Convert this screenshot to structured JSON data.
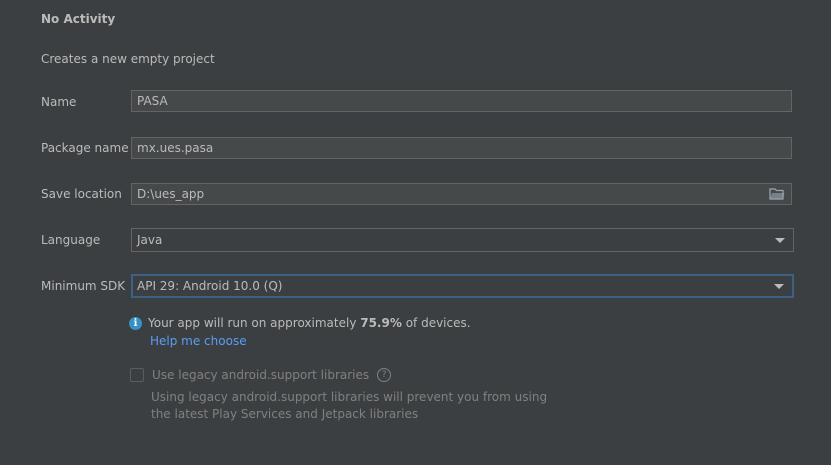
{
  "template": {
    "title": "No Activity",
    "description": "Creates a new empty project"
  },
  "form": {
    "name": {
      "label": "Name",
      "value": "PASA"
    },
    "package": {
      "label": "Package name",
      "value": "mx.ues.pasa"
    },
    "save_location": {
      "label": "Save location",
      "value": "D:\\ues_app"
    },
    "language": {
      "label": "Language",
      "value": "Java"
    },
    "min_sdk": {
      "label": "Minimum SDK",
      "value": "API 29: Android 10.0 (Q)"
    }
  },
  "info": {
    "prefix": "Your app will run on approximately ",
    "percent": "75.9%",
    "suffix": " of devices.",
    "help_link": "Help me choose"
  },
  "legacy": {
    "label": "Use legacy android.support libraries",
    "note_line1": "Using legacy android.support libraries will prevent you from using",
    "note_line2": "the latest Play Services and Jetpack libraries"
  },
  "colors": {
    "background": "#3c3f41",
    "field_bg": "#45494a",
    "focus_border": "#3d6185",
    "link": "#589df6",
    "info_icon": "#3592c4"
  }
}
